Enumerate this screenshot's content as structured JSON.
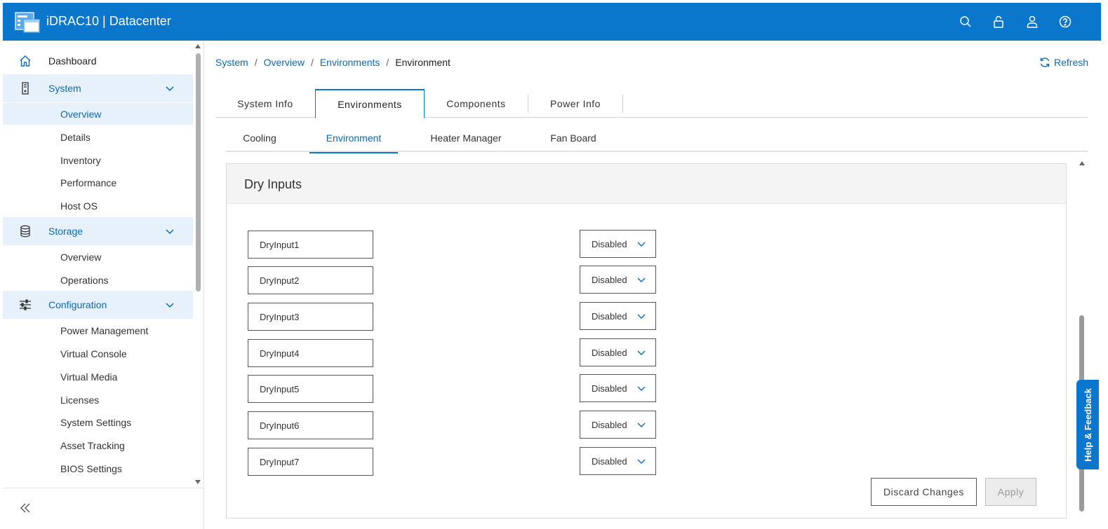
{
  "header": {
    "title": "iDRAC10 | Datacenter",
    "icons": [
      "search-icon",
      "lock-icon",
      "user-icon",
      "help-icon"
    ]
  },
  "sidebar": {
    "dashboard": "Dashboard",
    "system": {
      "label": "System",
      "items": [
        "Overview",
        "Details",
        "Inventory",
        "Performance",
        "Host OS"
      ]
    },
    "storage": {
      "label": "Storage",
      "items": [
        "Overview",
        "Operations"
      ]
    },
    "configuration": {
      "label": "Configuration",
      "items": [
        "Power Management",
        "Virtual Console",
        "Virtual Media",
        "Licenses",
        "System Settings",
        "Asset Tracking",
        "BIOS Settings"
      ]
    }
  },
  "breadcrumb": {
    "items": [
      "System",
      "Overview",
      "Environments"
    ],
    "current": "Environment"
  },
  "refresh_label": "Refresh",
  "tabs": [
    "System Info",
    "Environments",
    "Components",
    "Power Info"
  ],
  "active_tab": "Environments",
  "subtabs": [
    "Cooling",
    "Environment",
    "Heater Manager",
    "Fan Board"
  ],
  "active_subtab": "Environment",
  "panel": {
    "title": "Dry Inputs",
    "rows": [
      {
        "name": "DryInput1",
        "state": "Disabled"
      },
      {
        "name": "DryInput2",
        "state": "Disabled"
      },
      {
        "name": "DryInput3",
        "state": "Disabled"
      },
      {
        "name": "DryInput4",
        "state": "Disabled"
      },
      {
        "name": "DryInput5",
        "state": "Disabled"
      },
      {
        "name": "DryInput6",
        "state": "Disabled"
      },
      {
        "name": "DryInput7",
        "state": "Disabled"
      }
    ],
    "discard_label": "Discard Changes",
    "apply_label": "Apply"
  },
  "feedback_label": "Help & Feedback",
  "colors": {
    "brand": "#0a76cc",
    "link": "#0a6ab5",
    "active_bg": "#e6f1fb"
  }
}
